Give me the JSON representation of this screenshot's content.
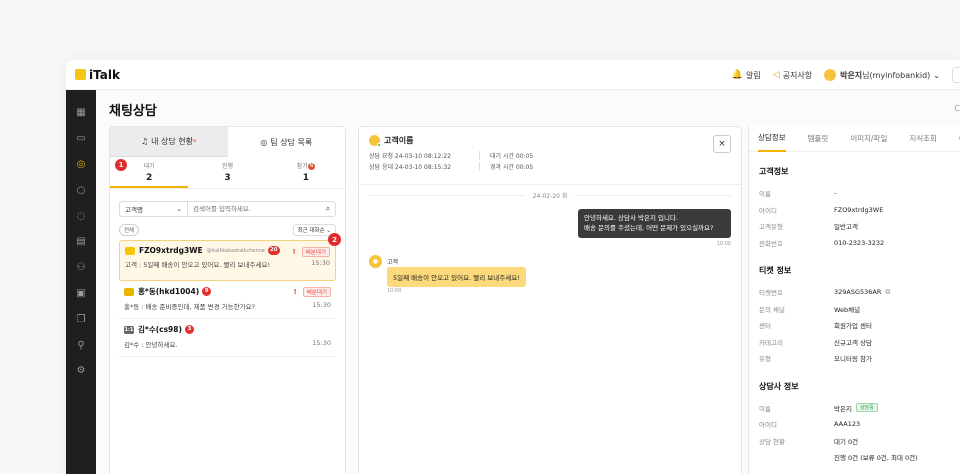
{
  "app": {
    "name": "iTalk"
  },
  "topbar": {
    "alarm": "알림",
    "notice": "공지사항",
    "user_name": "박은지",
    "user_suffix": "님(myinfobankid)"
  },
  "page": {
    "title": "채팅상담",
    "title_stub": "C"
  },
  "left_panel": {
    "tabs": [
      {
        "label": "내 상담 현황",
        "mark": "*"
      },
      {
        "label": "팀 상담 목록"
      }
    ],
    "counts": [
      {
        "label": "대기",
        "value": "2"
      },
      {
        "label": "진행",
        "value": "3"
      },
      {
        "label": "참가",
        "value": "1",
        "badge": "N"
      }
    ],
    "counts_badge": "1",
    "search": {
      "select_value": "고객명",
      "placeholder": "검색어를 입력하세요."
    },
    "filter": {
      "pill": "전체",
      "sort": "최근 대화순"
    },
    "items": [
      {
        "name": "FZO9xtrdg3WE",
        "sub": "@italkkakaotalkchenne",
        "badge": "20",
        "status": "배분대기",
        "message": "고객 : 5일째 배송이 안오고 있어요. 빨리 보내주세요!",
        "time": "15:30",
        "corner_badge": "2",
        "channel_color": "#f6c400"
      },
      {
        "name": "홍*동(hkd1004)",
        "badge": "9",
        "status": "배분대기",
        "message": "홍*동 : 배송 준비중인데, 제품 변경 가능한가요?",
        "time": "15:30",
        "channel_color": "#e8b400"
      },
      {
        "name": "김*수(cs98)",
        "badge": "3",
        "message": "김*수 : 안녕하세요.",
        "time": "15:30",
        "channel_label": "1:1",
        "channel_color": "#666666"
      }
    ]
  },
  "chat": {
    "customer_name": "고객이름",
    "request_label": "상담 요청 24-03-10 08:12:22",
    "wait_label": "대기 시간 00:05",
    "answer_label": "상담 응대 24-03-10 08:15:32",
    "elapsed_label": "경과 시간 00:05",
    "close_icon": "×",
    "date_divider": "24-02-20 화",
    "agent_message_line1": "안녕하세요. 상담사 박은지 입니다.",
    "agent_message_line2": "배송 문의를 주셨는데, 어떤 문제가 있으실까요?",
    "agent_time": "10:00",
    "customer_label": "고객",
    "customer_message": "5일째 배송이 안오고 있어요. 빨리 보내주세요!",
    "customer_time": "10:00"
  },
  "right_panel": {
    "tabs": [
      "상담정보",
      "템플릿",
      "이미지/파일",
      "지식조회",
      "C"
    ],
    "customer_section": {
      "title": "고객정보",
      "rows": [
        {
          "k": "이름",
          "v": "-"
        },
        {
          "k": "아이디",
          "v": "FZO9xtrdg3WE"
        },
        {
          "k": "고객유형",
          "v": "일반고객"
        },
        {
          "k": "전화번호",
          "v": "010-2323-3232"
        }
      ]
    },
    "ticket_section": {
      "title": "티켓 정보",
      "rows": [
        {
          "k": "티켓번호",
          "v": "329ASG536AR"
        },
        {
          "k": "문의 채널",
          "v": "Web채널"
        },
        {
          "k": "센터",
          "v": "회원가입 센터"
        },
        {
          "k": "카테고리",
          "v": "신규고객 상담"
        },
        {
          "k": "유형",
          "v": "모니터링 참가"
        }
      ]
    },
    "agent_section": {
      "title": "상담사 정보",
      "rows": [
        {
          "k": "이름",
          "v": "박은지",
          "tag": "상담중"
        },
        {
          "k": "아이디",
          "v": "AAA123"
        },
        {
          "k": "상담 현황",
          "v": "대기 0건"
        },
        {
          "k": "",
          "v": "진행 0건 (보류 0건, 최대 0건)"
        }
      ]
    }
  }
}
